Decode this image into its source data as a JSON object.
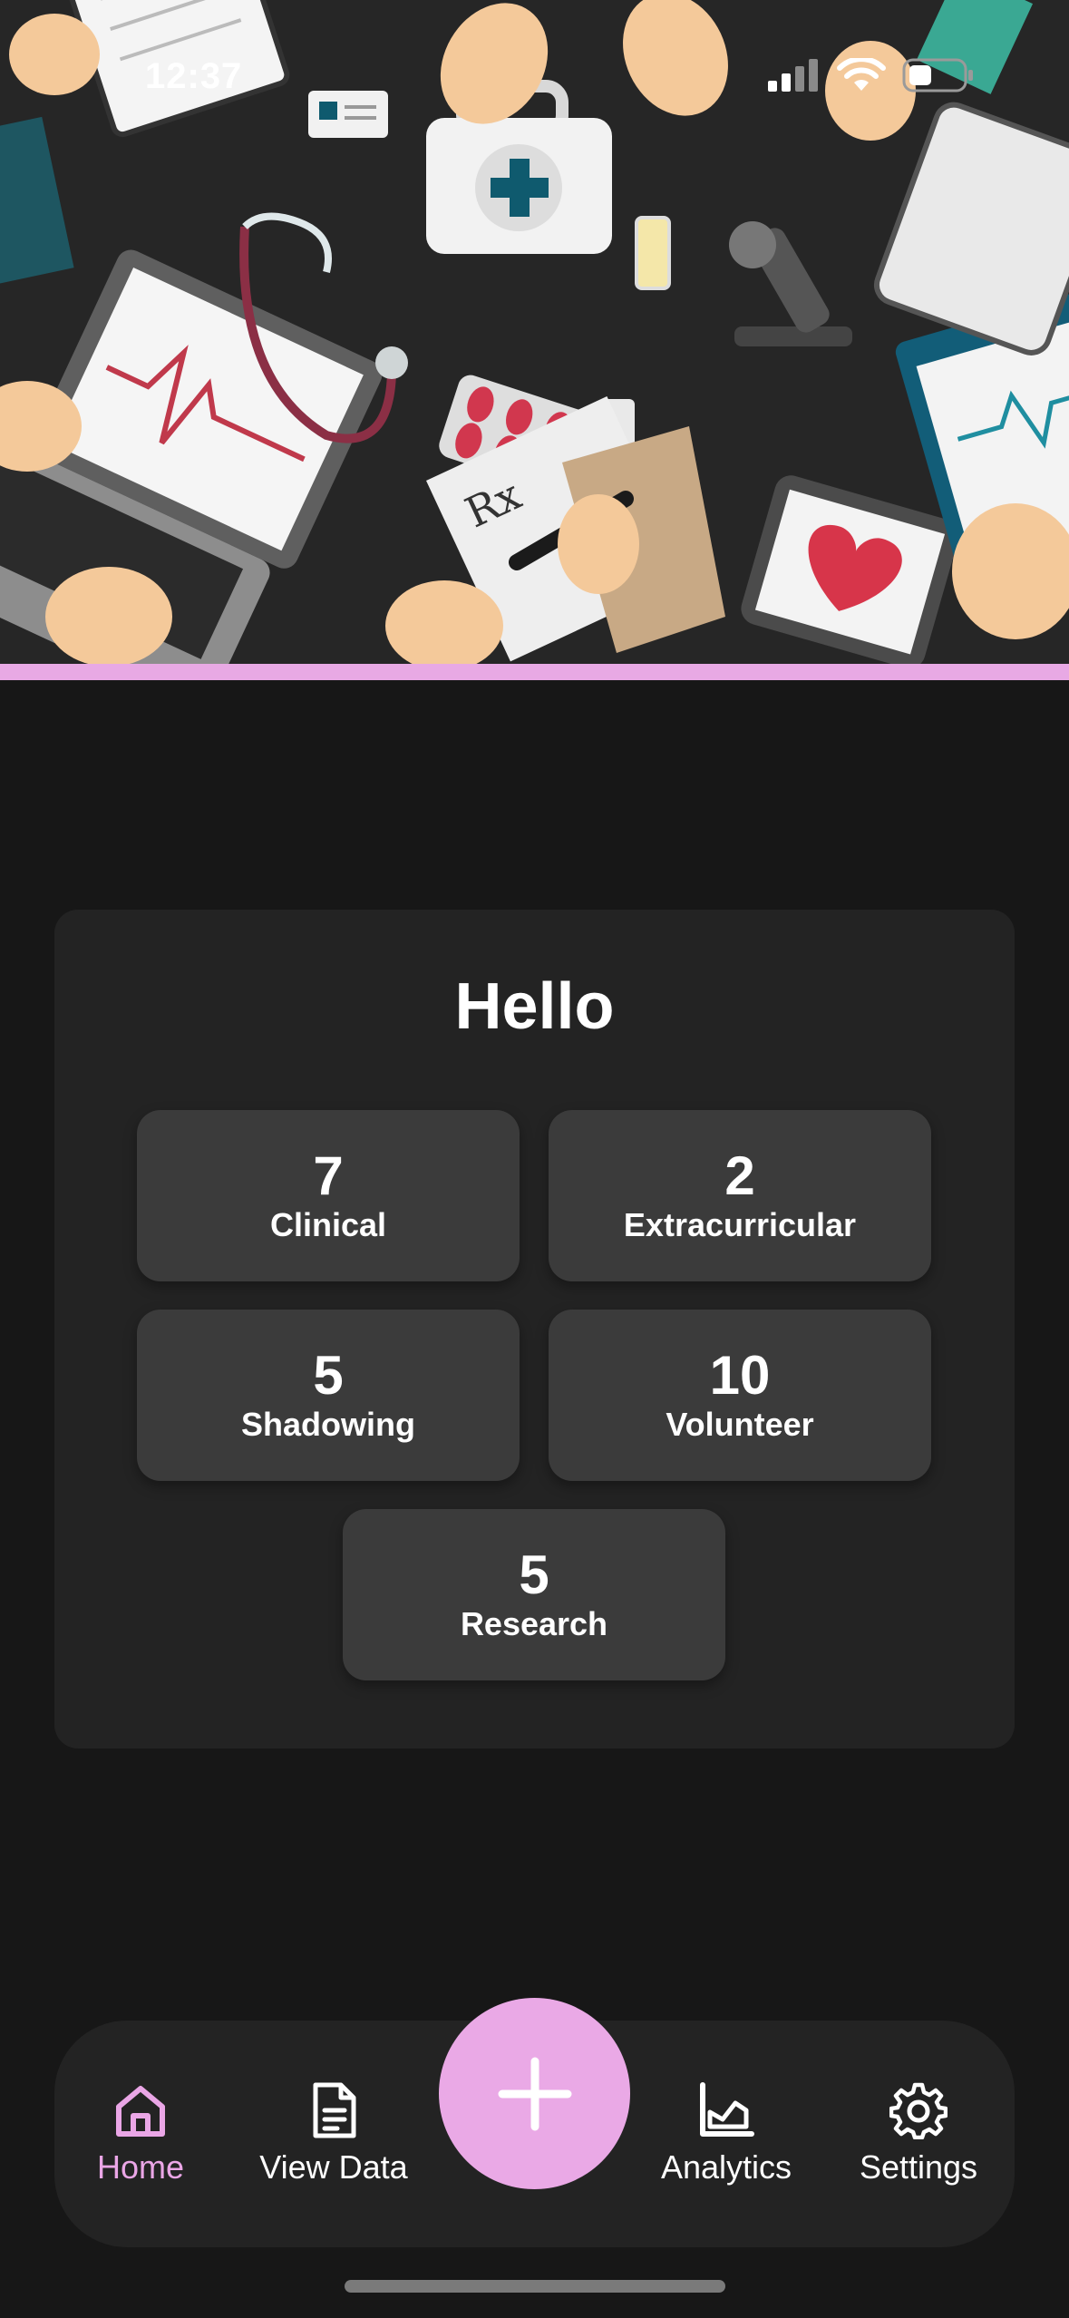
{
  "status_bar": {
    "time": "12:37"
  },
  "summary": {
    "greeting": "Hello",
    "stats": [
      {
        "value": "7",
        "label": "Clinical"
      },
      {
        "value": "2",
        "label": "Extracurricular"
      },
      {
        "value": "5",
        "label": "Shadowing"
      },
      {
        "value": "10",
        "label": "Volunteer"
      },
      {
        "value": "5",
        "label": "Research"
      }
    ]
  },
  "nav": {
    "home": "Home",
    "view_data": "View Data",
    "analytics": "Analytics",
    "settings": "Settings",
    "active": "home"
  },
  "icons": {
    "home": "home-icon",
    "view_data": "document-icon",
    "add": "plus-icon",
    "analytics": "chart-icon",
    "settings": "gear-icon"
  },
  "colors": {
    "background": "#171717",
    "card": "#232323",
    "tile": "#3b3b3b",
    "accent": "#eaa9e6"
  }
}
